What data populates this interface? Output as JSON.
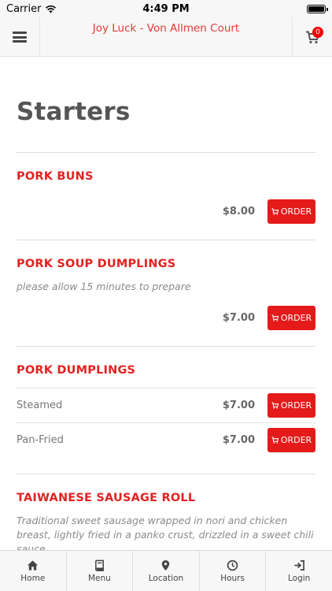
{
  "status_bar": {
    "carrier": "Carrier",
    "time": "4:49 PM"
  },
  "header": {
    "title": "Joy Luck - Von Allmen Court",
    "cart_count": "0"
  },
  "section": {
    "title": "Starters"
  },
  "items": [
    {
      "name": "PORK BUNS",
      "price": "$8.00",
      "order_label": "ORDER"
    },
    {
      "name": "PORK SOUP DUMPLINGS",
      "description": "please allow 15 minutes to prepare",
      "price": "$7.00",
      "order_label": "ORDER"
    },
    {
      "name": "PORK DUMPLINGS",
      "variants": [
        {
          "name": "Steamed",
          "price": "$7.00",
          "order_label": "ORDER"
        },
        {
          "name": "Pan-Fried",
          "price": "$7.00",
          "order_label": "ORDER"
        }
      ]
    },
    {
      "name": "TAIWANESE SAUSAGE ROLL",
      "description": "Traditional sweet sausage wrapped in nori and chicken breast, lightly fried in a panko crust, drizzled in a sweet chili sauce"
    }
  ],
  "tabs": [
    {
      "label": "Home",
      "icon": "home-icon"
    },
    {
      "label": "Menu",
      "icon": "book-icon"
    },
    {
      "label": "Location",
      "icon": "map-pin-icon"
    },
    {
      "label": "Hours",
      "icon": "clock-icon"
    },
    {
      "label": "Login",
      "icon": "login-icon"
    }
  ],
  "colors": {
    "accent": "#e51a1a",
    "title_red": "#e32222"
  }
}
